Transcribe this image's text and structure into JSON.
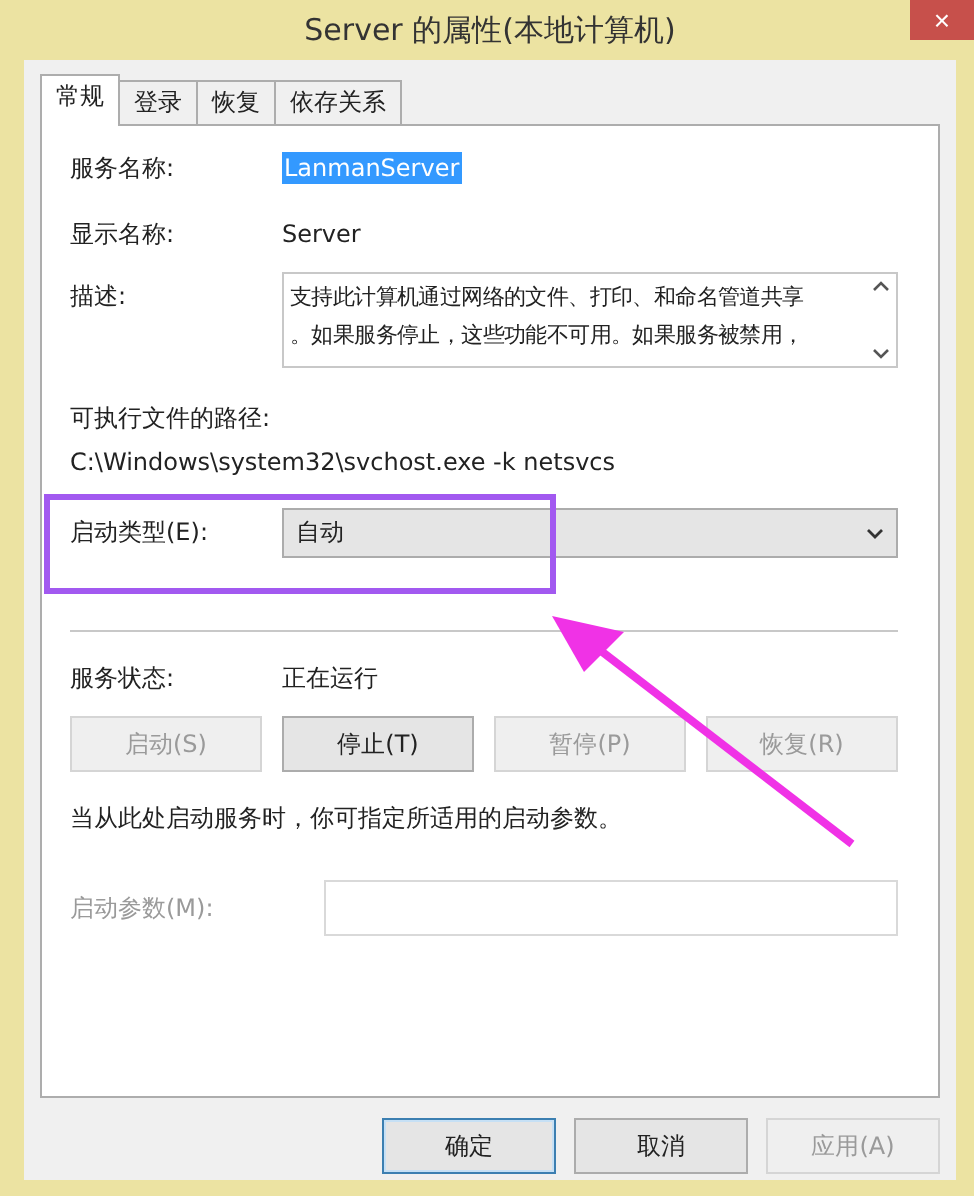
{
  "window": {
    "title": "Server 的属性(本地计算机)",
    "close": "×"
  },
  "tabs": [
    {
      "label": "常规",
      "selected": true
    },
    {
      "label": "登录",
      "selected": false
    },
    {
      "label": "恢复",
      "selected": false
    },
    {
      "label": "依存关系",
      "selected": false
    }
  ],
  "service_name": {
    "label": "服务名称:",
    "value": "LanmanServer",
    "selected": true
  },
  "display_name": {
    "label": "显示名称:",
    "value": "Server"
  },
  "description": {
    "label": "描述:",
    "lines": [
      "支持此计算机通过网络的文件、打印、和命名管道共享",
      "。如果服务停止，这些功能不可用。如果服务被禁用，"
    ]
  },
  "path": {
    "label": "可执行文件的路径:",
    "value": "C:\\Windows\\system32\\svchost.exe -k netsvcs"
  },
  "startup_type": {
    "label": "启动类型(E):",
    "value": "自动"
  },
  "service_status": {
    "label": "服务状态:",
    "value": "正在运行"
  },
  "service_buttons": [
    {
      "label": "启动(S)",
      "disabled": true
    },
    {
      "label": "停止(T)",
      "disabled": false
    },
    {
      "label": "暂停(P)",
      "disabled": true
    },
    {
      "label": "恢复(R)",
      "disabled": true
    }
  ],
  "hint": "当从此处启动服务时，你可指定所适用的启动参数。",
  "start_parameters": {
    "label": "启动参数(M):",
    "disabled": true
  },
  "dialog_buttons": [
    {
      "label": "确定",
      "default": true,
      "disabled": false
    },
    {
      "label": "取消",
      "default": false,
      "disabled": false
    },
    {
      "label": "应用(A)",
      "default": false,
      "disabled": true
    }
  ]
}
